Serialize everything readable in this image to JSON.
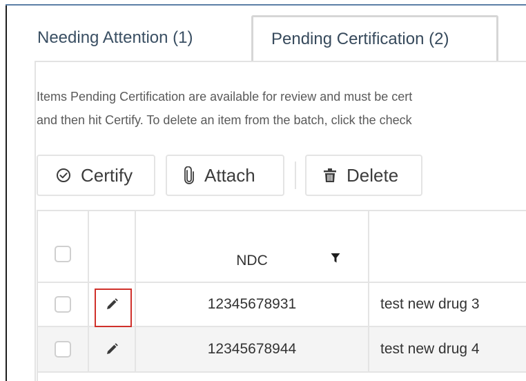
{
  "tabs": [
    {
      "label": "Needing Attention (1)",
      "active": false
    },
    {
      "label": "Pending Certification (2)",
      "active": true
    }
  ],
  "description": {
    "line1": "Items Pending Certification are available for review and must be cert",
    "line2": "and then hit Certify. To delete an item from the batch, click the check"
  },
  "toolbar": {
    "certify": {
      "label": "Certify",
      "icon": "check-circle-icon"
    },
    "attach": {
      "label": "Attach",
      "icon": "paperclip-icon"
    },
    "delete": {
      "label": "Delete",
      "icon": "trash-icon"
    }
  },
  "grid": {
    "columns": {
      "ndc": "NDC"
    },
    "rows": [
      {
        "ndc": "12345678931",
        "name": "test new drug 3",
        "edit_icon": "pencil-icon"
      },
      {
        "ndc": "12345678944",
        "name": "test new drug 4",
        "edit_icon": "pencil-icon"
      }
    ]
  },
  "colors": {
    "tab_text": "#3a4f63",
    "highlight": "#d0302a",
    "border": "#e4e4e4",
    "alt_row": "#f4f4f4"
  }
}
